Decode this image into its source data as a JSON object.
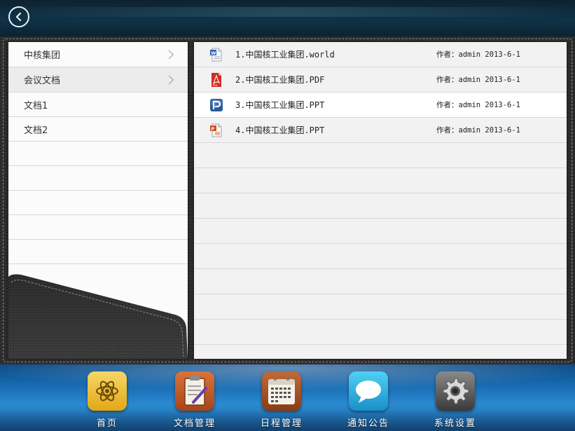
{
  "header": {
    "back_icon": "back-arrow-icon"
  },
  "sidebar": {
    "items": [
      {
        "label": "中核集团",
        "has_arrow": true
      },
      {
        "label": "会议文档",
        "has_arrow": true
      },
      {
        "label": "文档1",
        "has_arrow": false
      },
      {
        "label": "文档2",
        "has_arrow": false
      }
    ]
  },
  "files": {
    "items": [
      {
        "name": "1.中国核工业集团.world",
        "meta": "作者：admin 2013-6-1",
        "icon": "word-doc-icon"
      },
      {
        "name": "2.中国核工业集团.PDF",
        "meta": "作者：admin 2013-6-1",
        "icon": "pdf-icon"
      },
      {
        "name": "3.中国核工业集团.PPT",
        "meta": "作者：admin 2013-6-1",
        "icon": "ppt-icon",
        "selected": true
      },
      {
        "name": "4.中国核工业集团.PPT",
        "meta": "作者：admin 2013-6-1",
        "icon": "ppt-doc-icon"
      }
    ]
  },
  "dock": {
    "items": [
      {
        "label": "首页",
        "icon": "atom-icon"
      },
      {
        "label": "文档管理",
        "icon": "clipboard-pen-icon"
      },
      {
        "label": "日程管理",
        "icon": "calendar-icon"
      },
      {
        "label": "通知公告",
        "icon": "speech-bubble-icon"
      },
      {
        "label": "系统设置",
        "icon": "gear-icon"
      }
    ]
  },
  "colors": {
    "header_bg": "#0f3347",
    "dock_bg": "#1a6fb6",
    "leather": "#2b2b2b",
    "panel_bg": "#f2f2f2",
    "pdf_red": "#d42a20",
    "ppt_blue": "#2b5a9a"
  }
}
